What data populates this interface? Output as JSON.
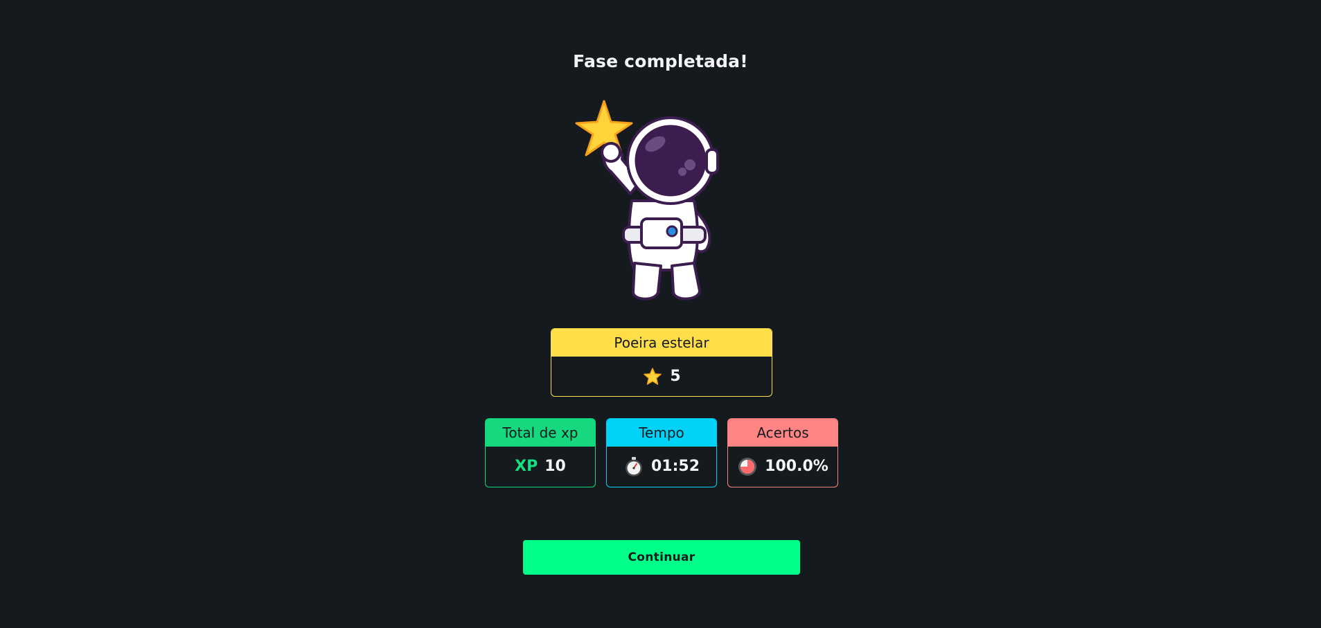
{
  "title": "Fase completada!",
  "mascot": {
    "icon": "astronaut-holding-star-icon"
  },
  "stardust": {
    "label": "Poeira estelar",
    "icon": "star-icon",
    "value": "5",
    "color": "#ffde4a"
  },
  "stats": {
    "xp": {
      "label": "Total de xp",
      "tag": "XP",
      "value": "10",
      "color": "#16d87f"
    },
    "time": {
      "label": "Tempo",
      "icon": "stopwatch-icon",
      "value": "01:52",
      "color": "#00d2f8"
    },
    "accuracy": {
      "label": "Acertos",
      "icon": "pie-chart-icon",
      "value": "100.0%",
      "color": "#ff8585"
    }
  },
  "continue_button": {
    "label": "Continuar",
    "color": "#00ff88"
  },
  "colors": {
    "background": "#151a1e"
  }
}
